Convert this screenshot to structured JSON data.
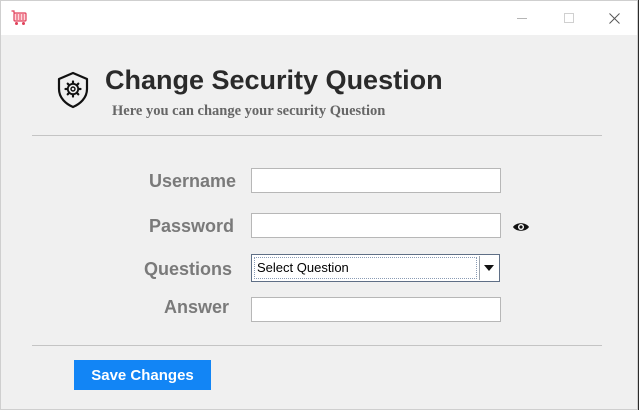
{
  "window": {
    "app_icon": "cart-icon",
    "controls": [
      "minimize-icon",
      "maximize-icon",
      "close-icon"
    ]
  },
  "header": {
    "icon": "shield-gear-icon",
    "title": "Change Security Question",
    "subtitle": "Here you can change your security Question"
  },
  "form": {
    "username": {
      "label": "Username",
      "value": ""
    },
    "password": {
      "label": "Password",
      "value": "",
      "toggle_icon": "eye-icon"
    },
    "question": {
      "label": "Questions",
      "selected": "Select Question"
    },
    "answer": {
      "label": "Answer",
      "value": ""
    }
  },
  "actions": {
    "save_label": "Save Changes"
  },
  "colors": {
    "accent": "#1285f5",
    "label": "#7a7a7a",
    "title": "#2a2a2a"
  }
}
